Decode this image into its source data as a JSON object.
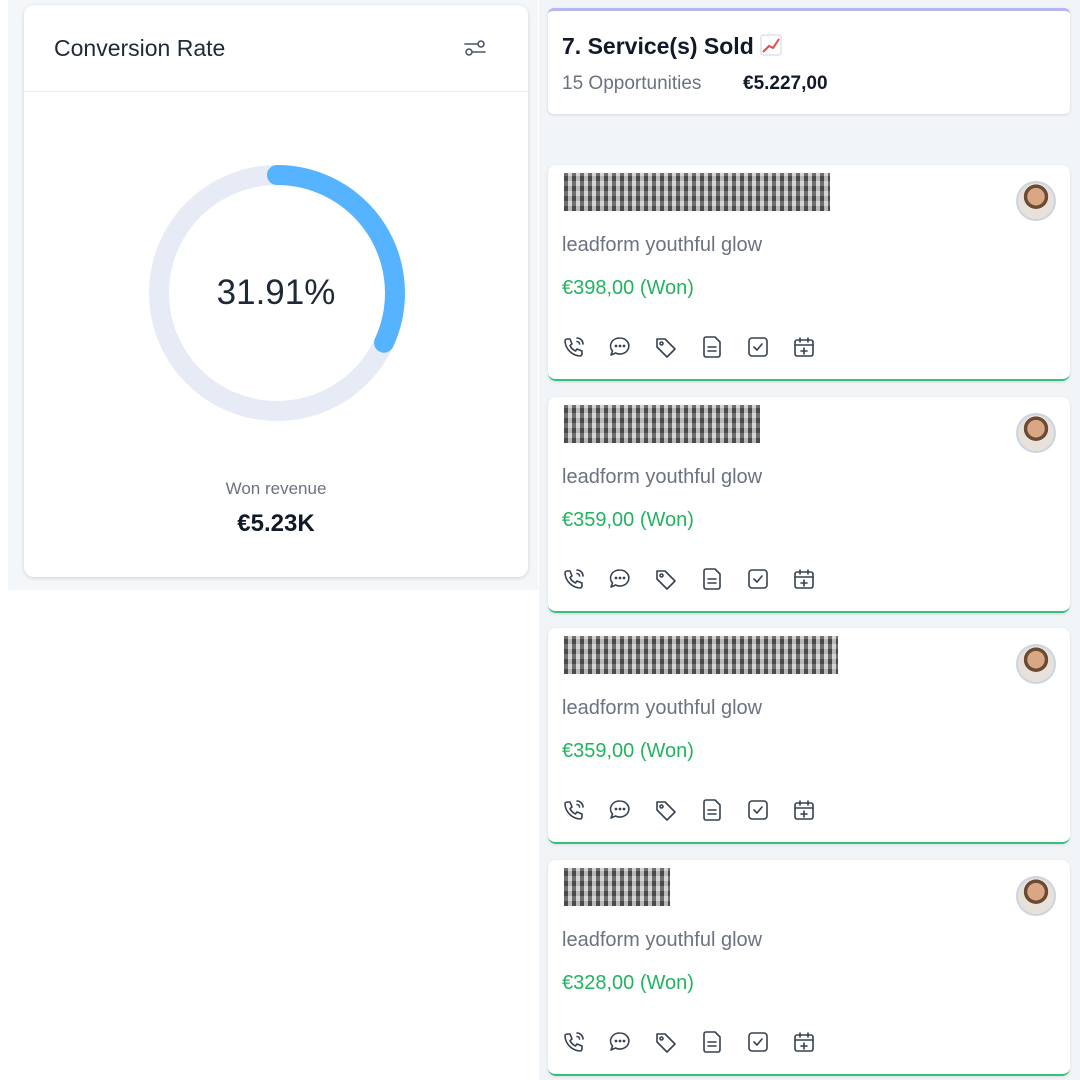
{
  "conversion": {
    "title": "Conversion Rate",
    "rate_text": "31.91%",
    "rate_fraction": 0.3191,
    "won_label": "Won revenue",
    "won_value": "€5.23K",
    "ring_color": "#55b3ff",
    "track_color": "#e6ebf6"
  },
  "stage": {
    "title": "7. Service(s) Sold",
    "count": "15 Opportunities",
    "sum": "€5.227,00"
  },
  "opportunities": [
    {
      "source": "leadform youthful glow",
      "value": "€398,00 (Won)"
    },
    {
      "source": "leadform youthful glow",
      "value": "€359,00 (Won)"
    },
    {
      "source": "leadform youthful glow",
      "value": "€359,00 (Won)"
    },
    {
      "source": "leadform youthful glow",
      "value": "€328,00 (Won)"
    }
  ],
  "action_icons": [
    "phone-icon",
    "chat-icon",
    "tag-icon",
    "note-icon",
    "task-icon",
    "calendar-add-icon"
  ],
  "colors": {
    "won_green": "#22b35e",
    "stage_accent": "#b8b5f4"
  }
}
